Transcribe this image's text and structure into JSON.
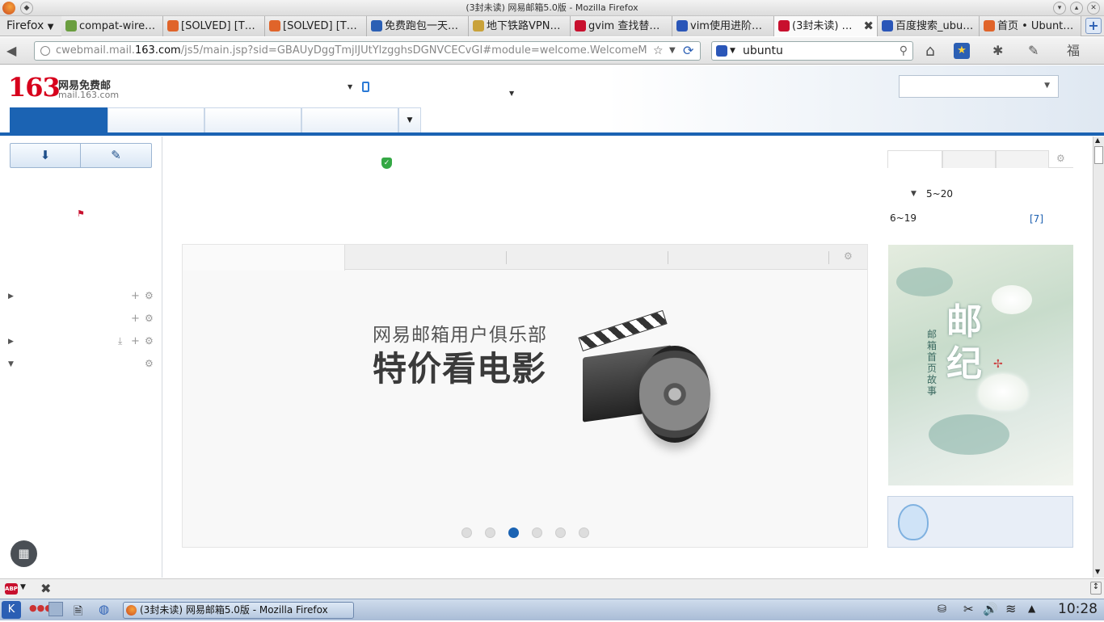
{
  "window": {
    "title": "(3封未读) 网易邮箱5.0版 - Mozilla Firefox"
  },
  "browser": {
    "menu_label": "Firefox",
    "tabs": [
      {
        "label": "compat-wire…",
        "color": "#6a9e3f"
      },
      {
        "label": "[SOLVED] [T…",
        "color": "#e0642a"
      },
      {
        "label": "[SOLVED] [T…",
        "color": "#e0642a"
      },
      {
        "label": "免费跑包一天…",
        "color": "#2b5fb4"
      },
      {
        "label": "地下铁路VPN…",
        "color": "#c9a23a"
      },
      {
        "label": "gvim 查找替…",
        "color": "#c8102e"
      },
      {
        "label": "vim使用进阶…",
        "color": "#2a56b8"
      },
      {
        "label": "(3封未读) …",
        "color": "#c8102e"
      },
      {
        "label": "百度搜索_ubu…",
        "color": "#2a56b8"
      },
      {
        "label": "首页 • Ubunt…",
        "color": "#e0642a"
      }
    ],
    "active_tab_index": 7,
    "url_prefix": "cwebmail.mail.",
    "url_domain": "163.com",
    "url_rest": "/js5/main.jsp?sid=GBAUyDggTmjlJUtYlzgghsDGNVCECvGI#module=welcome.WelcomeM",
    "search_value": "ubuntu"
  },
  "mail": {
    "logo_number": "163",
    "logo_name": "网易免费邮",
    "logo_domain": "mail.163.com",
    "weather_range": "5~20",
    "weather_next": "6~19",
    "count_link": "[7]",
    "banner_line1": "网易邮箱用户俱乐部",
    "banner_line2": "特价看电影",
    "side_story_line1": "邮纪",
    "side_story_line2": "邮箱首页故事",
    "carousel_dots": 6,
    "carousel_active": 2,
    "brand_color": "#1b63b3"
  },
  "taskbar": {
    "window_label": "(3封未读) 网易邮箱5.0版 - Mozilla Firefox",
    "clock": "10:28"
  }
}
